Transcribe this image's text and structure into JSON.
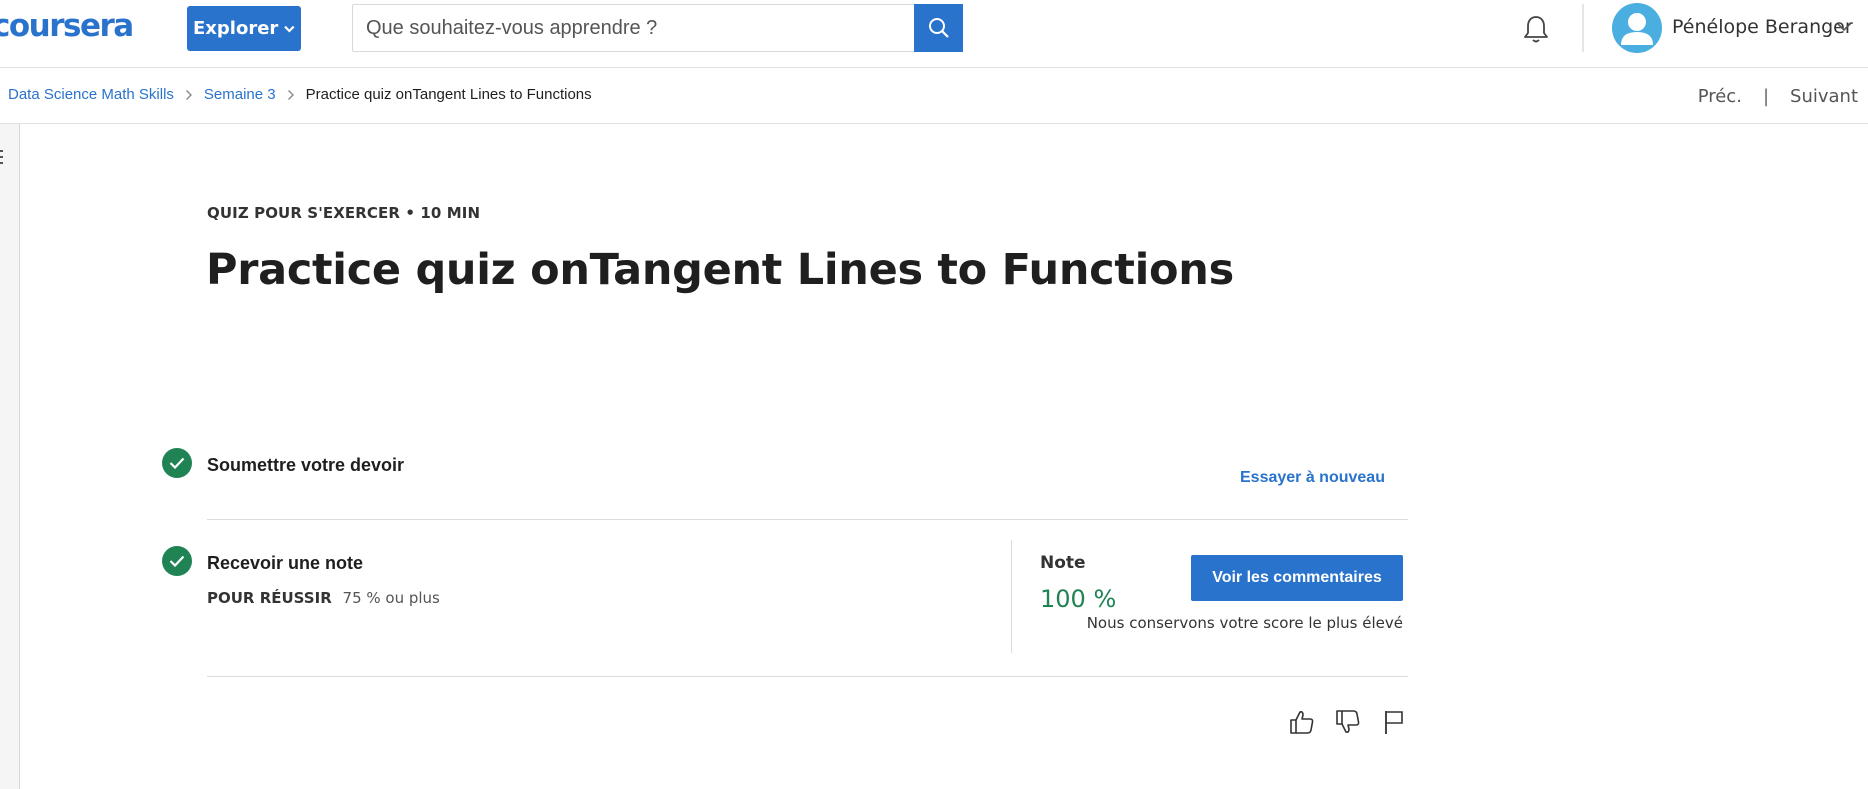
{
  "header": {
    "logo": "coursera",
    "explorer_label": "Explorer",
    "search_placeholder": "Que souhaitez-vous apprendre ?",
    "user_name": "Pénélope Beranger"
  },
  "breadcrumb": {
    "items": [
      "Data Science Math Skills",
      "Semaine 3",
      "Practice quiz onTangent Lines to Functions"
    ],
    "prev_label": "Préc.",
    "separator": "|",
    "next_label": "Suivant"
  },
  "quiz": {
    "kicker": "QUIZ POUR S'EXERCER • 10  MIN",
    "title": "Practice quiz onTangent Lines to Functions",
    "submit_step": {
      "title": "Soumettre votre devoir",
      "retry_label": "Essayer à nouveau"
    },
    "grade_step": {
      "title": "Recevoir une note",
      "pass_label": "POUR RÉUSSIR",
      "pass_value": "75 % ou plus",
      "grade_label": "Note",
      "grade_value": "100 %",
      "feedback_button": "Voir les commentaires",
      "score_note": "Nous conservons votre score le plus élevé"
    }
  },
  "colors": {
    "brand_blue": "#2a73cc",
    "success_green": "#1f8354",
    "avatar_blue": "#4aaee0"
  },
  "icons": [
    "search-icon",
    "bell-icon",
    "avatar-icon",
    "chevron-down-icon",
    "chevron-right-icon",
    "check-icon",
    "thumbs-up-icon",
    "thumbs-down-icon",
    "flag-icon",
    "menu-icon"
  ]
}
